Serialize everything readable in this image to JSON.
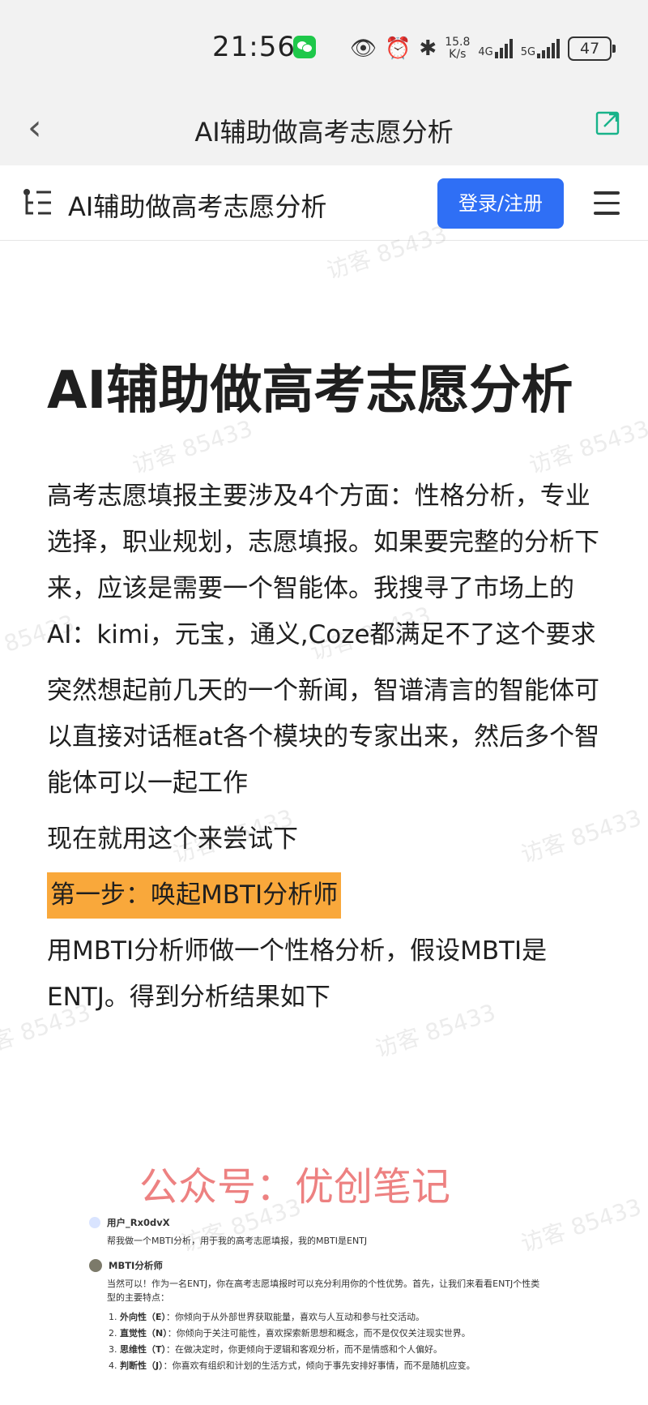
{
  "status": {
    "time": "21:56",
    "speed_top": "15.8",
    "speed_bottom": "K/s",
    "net1": "4G",
    "net2": "5G",
    "battery": "47"
  },
  "header": {
    "back_glyph": "‹",
    "title": "AI辅助做高考志愿分析"
  },
  "site": {
    "title": "AI辅助做高考志愿分析",
    "login_label": "登录/注册"
  },
  "article": {
    "title": "AI辅助做高考志愿分析",
    "paragraphs": [
      "高考志愿填报主要涉及4个方面：性格分析，专业选择，职业规划，志愿填报。如果要完整的分析下来，应该是需要一个智能体。我搜寻了市场上的AI：kimi，元宝，通义,Coze都满足不了这个要求",
      "突然想起前几天的一个新闻，智谱清言的智能体可以直接对话框at各个模块的专家出来，然后多个智能体可以一起工作",
      "现在就用这个来尝试下"
    ],
    "highlight": "第一步：唤起MBTI分析师",
    "paragraph_after": "用MBTI分析师做一个性格分析，假设MBTI是ENTJ。得到分析结果如下"
  },
  "watermark": {
    "text": "访客 85433",
    "gzh": "公众号：优创笔记"
  },
  "screenshot": {
    "user_name": "用户_Rx0dvX",
    "user_msg": "帮我做一个MBTI分析，用于我的高考志愿填报，我的MBTI是ENTJ",
    "bot_name": "MBTI分析师",
    "bot_intro": "当然可以！作为一名ENTJ，你在高考志愿填报时可以充分利用你的个性优势。首先，让我们来看看ENTJ个性类型的主要特点：",
    "traits": [
      {
        "label": "外向性（E）",
        "desc": "：你倾向于从外部世界获取能量，喜欢与人互动和参与社交活动。"
      },
      {
        "label": "直觉性（N）",
        "desc": "：你倾向于关注可能性，喜欢探索新思想和概念，而不是仅仅关注现实世界。"
      },
      {
        "label": "思维性（T）",
        "desc": "：在做决定时，你更倾向于逻辑和客观分析，而不是情感和个人偏好。"
      },
      {
        "label": "判断性（J）",
        "desc": "：你喜欢有组织和计划的生活方式，倾向于事先安排好事情，而不是随机应变。"
      }
    ]
  },
  "colors": {
    "accent": "#2f6ff5",
    "highlight": "#f9a83b",
    "wechat": "#1ec84a",
    "ext_icon": "#18b38a"
  }
}
